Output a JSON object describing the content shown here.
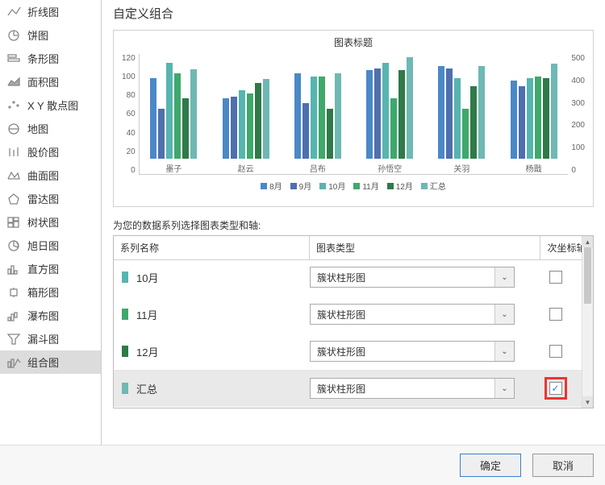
{
  "title": "自定义组合",
  "sidebar": {
    "items": [
      {
        "label": "折线图",
        "selected": false
      },
      {
        "label": "饼图",
        "selected": false
      },
      {
        "label": "条形图",
        "selected": false
      },
      {
        "label": "面积图",
        "selected": false
      },
      {
        "label": "X Y 散点图",
        "selected": false
      },
      {
        "label": "地图",
        "selected": false
      },
      {
        "label": "股价图",
        "selected": false
      },
      {
        "label": "曲面图",
        "selected": false
      },
      {
        "label": "雷达图",
        "selected": false
      },
      {
        "label": "树状图",
        "selected": false
      },
      {
        "label": "旭日图",
        "selected": false
      },
      {
        "label": "直方图",
        "selected": false
      },
      {
        "label": "箱形图",
        "selected": false
      },
      {
        "label": "瀑布图",
        "selected": false
      },
      {
        "label": "漏斗图",
        "selected": false
      },
      {
        "label": "组合图",
        "selected": true
      }
    ]
  },
  "instruction": "为您的数据系列选择图表类型和轴:",
  "columns": {
    "series_name": "系列名称",
    "chart_type": "图表类型",
    "secondary": "次坐标轴"
  },
  "rows": [
    {
      "label": "10月",
      "type": "簇状柱形图",
      "color": "#57b5b0",
      "secondary": false,
      "highlight": false
    },
    {
      "label": "11月",
      "type": "簇状柱形图",
      "color": "#3fa86b",
      "secondary": false,
      "highlight": false
    },
    {
      "label": "12月",
      "type": "簇状柱形图",
      "color": "#2f7a48",
      "secondary": false,
      "highlight": false
    },
    {
      "label": "汇总",
      "type": "簇状柱形图",
      "color": "#6fb8b3",
      "secondary": true,
      "highlight": true
    }
  ],
  "buttons": {
    "ok": "确定",
    "cancel": "取消"
  },
  "chart_data": {
    "type": "bar",
    "title": "图表标题",
    "categories": [
      "墨子",
      "赵云",
      "吕布",
      "孙悟空",
      "关羽",
      "杨戬"
    ],
    "series": [
      {
        "name": "8月",
        "color": "#4a88c8",
        "values": [
          80,
          60,
          85,
          88,
          92,
          78
        ]
      },
      {
        "name": "9月",
        "color": "#4f6fae",
        "values": [
          50,
          62,
          55,
          90,
          90,
          72
        ]
      },
      {
        "name": "10月",
        "color": "#57b5b0",
        "values": [
          95,
          68,
          82,
          95,
          80,
          80
        ]
      },
      {
        "name": "11月",
        "color": "#3fa86b",
        "values": [
          85,
          65,
          82,
          60,
          50,
          82
        ]
      },
      {
        "name": "12月",
        "color": "#2f7a48",
        "values": [
          60,
          75,
          50,
          88,
          72,
          80
        ]
      },
      {
        "name": "汇总",
        "color": "#6fb8b3",
        "values": [
          370,
          330,
          354,
          421,
          384,
          392
        ]
      }
    ],
    "ylim_left": [
      0,
      120
    ],
    "ylim_right": [
      0,
      500
    ],
    "yticks_left": [
      0,
      20,
      40,
      60,
      80,
      100,
      120
    ],
    "yticks_right": [
      0,
      100,
      200,
      300,
      400,
      500
    ]
  }
}
